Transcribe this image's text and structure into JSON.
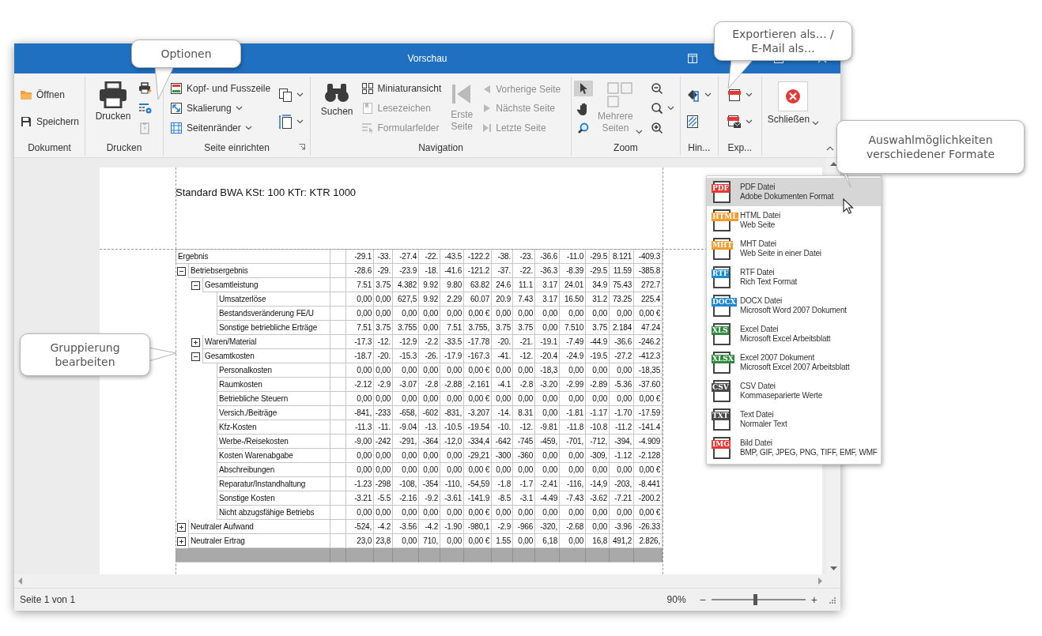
{
  "window": {
    "title": "Vorschau"
  },
  "ribbon": {
    "groups": [
      {
        "label": "Dokument",
        "columns": [
          {
            "kind": "stack",
            "items": [
              {
                "label": "Öffnen",
                "disabled": false,
                "dropdown": false,
                "selected": false
              },
              {
                "label": "Speichern",
                "disabled": false,
                "dropdown": false,
                "selected": false
              }
            ]
          }
        ]
      },
      {
        "label": "Drucken",
        "columns": [
          {
            "kind": "large",
            "items": [
              {
                "label": "Drucken",
                "disabled": false,
                "dropdown": false,
                "selected": false
              }
            ]
          },
          {
            "kind": "stack",
            "items": [
              {
                "disabled": false,
                "dropdown": false,
                "selected": false
              },
              {
                "disabled": false,
                "dropdown": false,
                "selected": false
              },
              {
                "disabled": true,
                "dropdown": false,
                "selected": false
              }
            ]
          }
        ]
      },
      {
        "label": "Seite einrichten",
        "columns": [
          {
            "kind": "stack",
            "items": [
              {
                "label": "Kopf- und Fusszeile",
                "disabled": false,
                "dropdown": false,
                "selected": false
              },
              {
                "label": "Skalierung",
                "disabled": false,
                "dropdown": true,
                "selected": false
              },
              {
                "label": "Seitenränder",
                "disabled": false,
                "dropdown": true,
                "selected": false
              }
            ]
          },
          {
            "kind": "stack",
            "items": [
              {
                "disabled": false,
                "dropdown": true,
                "selected": false
              },
              {
                "disabled": false,
                "dropdown": true,
                "selected": false
              }
            ]
          }
        ]
      },
      {
        "label": "Navigation",
        "columns": [
          {
            "kind": "large",
            "items": [
              {
                "label": "Suchen",
                "disabled": false,
                "dropdown": false,
                "selected": false
              }
            ]
          },
          {
            "kind": "stack",
            "items": [
              {
                "label": "Miniaturansicht",
                "disabled": false,
                "dropdown": false,
                "selected": false
              },
              {
                "label": "Lesezeichen",
                "disabled": true,
                "dropdown": false,
                "selected": false
              },
              {
                "label": "Formularfelder",
                "disabled": true,
                "dropdown": false,
                "selected": false
              }
            ]
          },
          {
            "kind": "large",
            "items": [
              {
                "label": "Erste Seite",
                "disabled": true,
                "dropdown": false,
                "selected": false
              }
            ]
          },
          {
            "kind": "stack",
            "items": [
              {
                "label": "Vorherige Seite",
                "disabled": true,
                "dropdown": false,
                "selected": false
              },
              {
                "label": "Nächste Seite",
                "disabled": true,
                "dropdown": false,
                "selected": false
              },
              {
                "label": "Letzte Seite",
                "disabled": true,
                "dropdown": false,
                "selected": false
              }
            ]
          }
        ]
      },
      {
        "label": "Zoom",
        "columns": [
          {
            "kind": "stack",
            "items": [
              {
                "disabled": false,
                "dropdown": false,
                "selected": true
              },
              {
                "disabled": false,
                "dropdown": false,
                "selected": false
              },
              {
                "disabled": false,
                "dropdown": false,
                "selected": false
              }
            ]
          },
          {
            "kind": "large",
            "items": [
              {
                "label": "Mehrere Seiten",
                "disabled": true,
                "dropdown": true,
                "selected": false
              }
            ]
          },
          {
            "kind": "stack",
            "items": [
              {
                "disabled": false,
                "dropdown": false,
                "selected": false
              },
              {
                "disabled": false,
                "dropdown": true,
                "selected": false
              },
              {
                "disabled": false,
                "dropdown": false,
                "selected": false
              }
            ]
          }
        ]
      },
      {
        "label": "Hin...",
        "columns": [
          {
            "kind": "stack",
            "items": [
              {
                "disabled": false,
                "dropdown": true,
                "selected": false
              },
              {
                "disabled": false,
                "dropdown": false,
                "selected": false
              }
            ]
          }
        ]
      },
      {
        "label": "Exp...",
        "columns": [
          {
            "kind": "stack",
            "items": [
              {
                "disabled": false,
                "dropdown": true,
                "selected": false
              },
              {
                "disabled": false,
                "dropdown": true,
                "selected": false
              }
            ]
          }
        ]
      },
      {
        "columns": [
          {
            "kind": "large",
            "items": [
              {
                "label": "Schließen",
                "disabled": false,
                "dropdown": true,
                "selected": false
              }
            ]
          }
        ]
      }
    ]
  },
  "document": {
    "title": "Standard BWA KSt: 100 KTr: KTR 1000",
    "rows": [
      {
        "label": "Ergebnis",
        "values": [
          "-29.1",
          "-33.",
          "-27.4",
          "-22.",
          "-43.5",
          "-122.2",
          "-38.",
          "-23.",
          "-36.6",
          "-11.0",
          "-29.5",
          "8.121",
          "-409.3"
        ]
      },
      {
        "label": "Betriebsergebnis",
        "expanded": true,
        "values": [
          "-28.6",
          "-29.",
          "-23.9",
          "-18.",
          "-41.6",
          "-121.2",
          "-37.",
          "-22.",
          "-36.3",
          "-8.39",
          "-29.5",
          "11.59",
          "-385.8"
        ],
        "children": [
          {
            "label": "Gesamtleistung",
            "expanded": true,
            "values": [
              "7.51",
              "3.75",
              "4.382",
              "9.92",
              "9.80",
              "63.82",
              "24.6",
              "11.1",
              "3.17",
              "24.01",
              "34.9",
              "75.43",
              "272.7"
            ],
            "children": [
              {
                "label": "Umsatzerlöse",
                "values": [
                  "0,00",
                  "0,00",
                  "627,5",
                  "9.92",
                  "2.29",
                  "60.07",
                  "20.9",
                  "7.43",
                  "3.17",
                  "16.50",
                  "31.2",
                  "73.25",
                  "225.4"
                ]
              },
              {
                "label": "Bestandsveränderung FE/U",
                "values": [
                  "0,00",
                  "0,00",
                  "0,00",
                  "0,00",
                  "0,00",
                  "0,00 €",
                  "0,00",
                  "0,00",
                  "0,00",
                  "0,00",
                  "0,00",
                  "0,00",
                  "0,00 €"
                ]
              },
              {
                "label": "Sonstige betriebliche Erträge",
                "values": [
                  "7.51",
                  "3.75",
                  "3.755",
                  "0,00",
                  "7.51",
                  "3.755,",
                  "3.75",
                  "3.75",
                  "0,00",
                  "7.510",
                  "3.75",
                  "2.184",
                  "47.24"
                ]
              }
            ]
          },
          {
            "label": "Waren/Material",
            "expanded": false,
            "values": [
              "-17.3",
              "-12.",
              "-12.9",
              "-2.2",
              "-33.5",
              "-17.78",
              "-20.",
              "-21.",
              "-19.1",
              "-7.49",
              "-44.9",
              "-36.6",
              "-246.2"
            ]
          },
          {
            "label": "Gesamtkosten",
            "expanded": true,
            "values": [
              "-18.7",
              "-20.",
              "-15.3",
              "-26.",
              "-17.9",
              "-167.3",
              "-41.",
              "-12.",
              "-20.4",
              "-24.9",
              "-19.5",
              "-27.2",
              "-412.3"
            ],
            "children": [
              {
                "label": "Personalkosten",
                "values": [
                  "0,00",
                  "0,00",
                  "0,00",
                  "0,00",
                  "0,00",
                  "0,00 €",
                  "0,00",
                  "0,00",
                  "-18,3",
                  "0,00",
                  "0,00",
                  "0,00",
                  "-18,35"
                ]
              },
              {
                "label": "Raumkosten",
                "values": [
                  "-2.12",
                  "-2.9",
                  "-3.07",
                  "-2.8",
                  "-2.88",
                  "-2.161",
                  "-4.1",
                  "-2.8",
                  "-3.20",
                  "-2.99",
                  "-2.89",
                  "-5.36",
                  "-37.60"
                ]
              },
              {
                "label": "Betriebliche Steuern",
                "values": [
                  "0,00",
                  "0,00",
                  "0,00",
                  "0,00",
                  "0,00",
                  "0,00 €",
                  "0,00",
                  "0,00",
                  "0,00",
                  "0,00",
                  "0,00",
                  "0,00",
                  "0,00 €"
                ]
              },
              {
                "label": "Versich./Beiträge",
                "values": [
                  "-841,",
                  "-233",
                  "-658,",
                  "-602",
                  "-831,",
                  "-3.207",
                  "-14.",
                  "8.31",
                  "0,00",
                  "-1.81",
                  "-1.17",
                  "-1.70",
                  "-17.59"
                ]
              },
              {
                "label": "Kfz-Kosten",
                "values": [
                  "-11.3",
                  "-11.",
                  "-9.04",
                  "-13.",
                  "-10.5",
                  "-19.54",
                  "-10.",
                  "-12.",
                  "-9.81",
                  "-11.8",
                  "-10.8",
                  "-11.2",
                  "-141.4"
                ]
              },
              {
                "label": "Werbe-/Reisekosten",
                "values": [
                  "-9,00",
                  "-242",
                  "-291,",
                  "-364",
                  "-12,0",
                  "-334,4",
                  "-642",
                  "-745",
                  "-459,",
                  "-701,",
                  "-712,",
                  "-394,",
                  "-4.909"
                ]
              },
              {
                "label": "Kosten Warenabgabe",
                "values": [
                  "0,00",
                  "0,00",
                  "0,00",
                  "0,00",
                  "0,00",
                  "-29,21",
                  "-300",
                  "-360",
                  "0,00",
                  "0,00",
                  "-309,",
                  "-1.12",
                  "-2.128"
                ]
              },
              {
                "label": "Abschreibungen",
                "values": [
                  "0,00",
                  "0,00",
                  "0,00",
                  "0,00",
                  "0,00",
                  "0,00 €",
                  "0,00",
                  "0,00",
                  "0,00",
                  "0,00",
                  "0,00",
                  "0,00",
                  "0,00 €"
                ]
              },
              {
                "label": "Reparatur/Instandhaltung",
                "values": [
                  "-1.23",
                  "-298",
                  "-108,",
                  "-354",
                  "-110,",
                  "-54,59",
                  "-1.8",
                  "-1.7",
                  "-2.41",
                  "-116,",
                  "-14,9",
                  "-203,",
                  "-8.441"
                ]
              },
              {
                "label": "Sonstige Kosten",
                "values": [
                  "-3.21",
                  "-5.5",
                  "-2.16",
                  "-9.2",
                  "-3.61",
                  "-141.9",
                  "-8.5",
                  "-3.1",
                  "-4.49",
                  "-7.43",
                  "-3.62",
                  "-7.21",
                  "-200.2"
                ]
              },
              {
                "label": "Nicht abzugsfähige Betriebs",
                "values": [
                  "0,00",
                  "0,00",
                  "0,00",
                  "0,00",
                  "0,00",
                  "0,00 €",
                  "0,00",
                  "0,00",
                  "0,00",
                  "0,00",
                  "0,00",
                  "0,00",
                  "0,00 €"
                ]
              }
            ]
          }
        ]
      },
      {
        "label": "Neutraler Aufwand",
        "expanded": false,
        "values": [
          "-524,",
          "-4.2",
          "-3.56",
          "-4.2",
          "-1.90",
          "-980,1",
          "-2.9",
          "-966",
          "-320,",
          "-2.68",
          "0,00",
          "-3.96",
          "-26.33"
        ]
      },
      {
        "label": "Neutraler Ertrag",
        "expanded": false,
        "values": [
          "23,0",
          "23,8",
          "0,00",
          "710,",
          "0,00",
          "0,00 €",
          "1.55",
          "0,00",
          "6,18",
          "0,00",
          "16,8",
          "491,2",
          "2.826,"
        ]
      }
    ]
  },
  "export_menu": {
    "items": [
      {
        "badge": "PDF",
        "color": "#e53935",
        "title": "PDF Datei",
        "subtitle": "Adobe Dokumenten Format",
        "selected": true
      },
      {
        "badge": "HTML",
        "color": "#f39a2b",
        "title": "HTML Datei",
        "subtitle": "Web Seite",
        "selected": false
      },
      {
        "badge": "MHT",
        "color": "#f39a2b",
        "title": "MHT Datei",
        "subtitle": "Web Seite in einer Datei",
        "selected": false
      },
      {
        "badge": "RTF",
        "color": "#1e88d0",
        "title": "RTF Datei",
        "subtitle": "Rich Text Format",
        "selected": false
      },
      {
        "badge": "DOCX",
        "color": "#1e88d0",
        "title": "DOCX Datei",
        "subtitle": "Microsoft Word 2007 Dokument",
        "selected": false
      },
      {
        "badge": "XLS",
        "color": "#2e8b3e",
        "title": "Excel Datei",
        "subtitle": "Microsoft Excel Arbeitsblatt",
        "selected": false
      },
      {
        "badge": "XLSX",
        "color": "#2e8b3e",
        "title": "Excel 2007 Dokument",
        "subtitle": "Microsoft Excel 2007 Arbeitsblatt",
        "selected": false
      },
      {
        "badge": "CSV",
        "color": "#4a4a4a",
        "title": "CSV Datei",
        "subtitle": "Kommaseparierte Werte",
        "selected": false
      },
      {
        "badge": "TXT",
        "color": "#4a4a4a",
        "title": "Text Datei",
        "subtitle": "Normaler Text",
        "selected": false
      },
      {
        "badge": "IMG",
        "color": "#e53935",
        "title": "Bild Datei",
        "subtitle": "BMP, GIF, JPEG, PNG, TIFF, EMF, WMF",
        "selected": false
      }
    ]
  },
  "status_bar": {
    "page": "Seite 1 von 1",
    "zoom": "90%",
    "zoom_out": "−",
    "zoom_in": "+",
    "zoom_slider": {
      "level": 0.46
    }
  },
  "callouts": [
    {
      "text": "Optionen"
    },
    {
      "text": "Exportieren als… /\nE-Mail als…"
    },
    {
      "text": "Auswahlmöglichkeiten\nverschiedener Formate"
    },
    {
      "text": "Gruppierung\nbearbeiten"
    }
  ]
}
